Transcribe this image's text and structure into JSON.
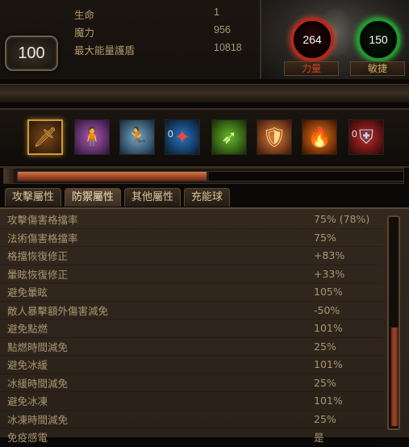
{
  "character": {
    "level": "100",
    "stats": [
      {
        "label": "生命",
        "value": "1"
      },
      {
        "label": "魔力",
        "value": "956"
      },
      {
        "label": "最大能量護盾",
        "value": "10818"
      }
    ]
  },
  "attributes": {
    "strength": {
      "value": "264",
      "label": "力量"
    },
    "dexterity": {
      "value": "150",
      "label": "敏捷"
    }
  },
  "skills": [
    {
      "name": "sword-skill",
      "glyph": "🗡",
      "count": ""
    },
    {
      "name": "spectral-figure-skill",
      "glyph": "🧍",
      "count": ""
    },
    {
      "name": "ice-dash-skill",
      "glyph": "🏃",
      "count": ""
    },
    {
      "name": "blue-aura-skill",
      "glyph": "✦",
      "count": "0"
    },
    {
      "name": "green-arrow-skill",
      "glyph": "➶",
      "count": ""
    },
    {
      "name": "fire-shield-skill",
      "glyph": "🛡",
      "count": ""
    },
    {
      "name": "fire-figure-skill",
      "glyph": "🔥",
      "count": ""
    },
    {
      "name": "red-armor-skill",
      "glyph": "⛨",
      "count": "0"
    }
  ],
  "progress": {
    "fill": 0.49
  },
  "tabs": [
    "攻擊屬性",
    "防禦屬性",
    "其他屬性",
    "充能球"
  ],
  "active_tab": 1,
  "defense_stats": [
    {
      "label": "攻擊傷害格擋率",
      "value": "75% (78%)"
    },
    {
      "label": "法術傷害格擋率",
      "value": "75%"
    },
    {
      "label": "格擋恢復修正",
      "value": "+83%"
    },
    {
      "label": "暈眩恢復修正",
      "value": "+33%"
    },
    {
      "label": "避免暈眩",
      "value": "105%"
    },
    {
      "label": "敵人暴擊額外傷害減免",
      "value": "-50%"
    },
    {
      "label": "避免點燃",
      "value": "101%"
    },
    {
      "label": "點燃時間減免",
      "value": "25%"
    },
    {
      "label": "避免冰緩",
      "value": "101%"
    },
    {
      "label": "冰緩時間減免",
      "value": "25%"
    },
    {
      "label": "避免冰凍",
      "value": "101%"
    },
    {
      "label": "冰凍時間減免",
      "value": "25%"
    },
    {
      "label": "免疫感電",
      "value": "是"
    }
  ],
  "scrollbar": {
    "thumb_start": 0.52,
    "thumb_end": 1.0
  },
  "colors": {
    "strength": "#b42818",
    "dexterity": "#1c9a2c",
    "text": "#a99671",
    "panel": "#2f251c"
  }
}
